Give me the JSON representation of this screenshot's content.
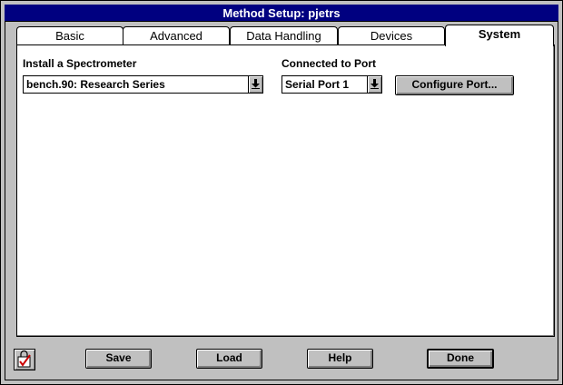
{
  "window": {
    "title": "Method Setup: pjetrs"
  },
  "tabs": [
    {
      "label": "Basic"
    },
    {
      "label": "Advanced"
    },
    {
      "label": "Data Handling"
    },
    {
      "label": "Devices"
    },
    {
      "label": "System",
      "active": true
    }
  ],
  "system": {
    "spectrometer_label": "Install a Spectrometer",
    "spectrometer_value": "bench.90: Research Series",
    "port_label": "Connected to Port",
    "port_value": "Serial Port 1",
    "configure_label": "Configure Port..."
  },
  "footer": {
    "save_label": "Save",
    "load_label": "Load",
    "help_label": "Help",
    "done_label": "Done"
  },
  "icons": {
    "combo_arrow": "dropdown-arrow-icon",
    "lock": "checkmark-lock-icon"
  },
  "colors": {
    "titlebar": "#000080",
    "face": "#c0c0c0",
    "accent": "#cc0000"
  }
}
